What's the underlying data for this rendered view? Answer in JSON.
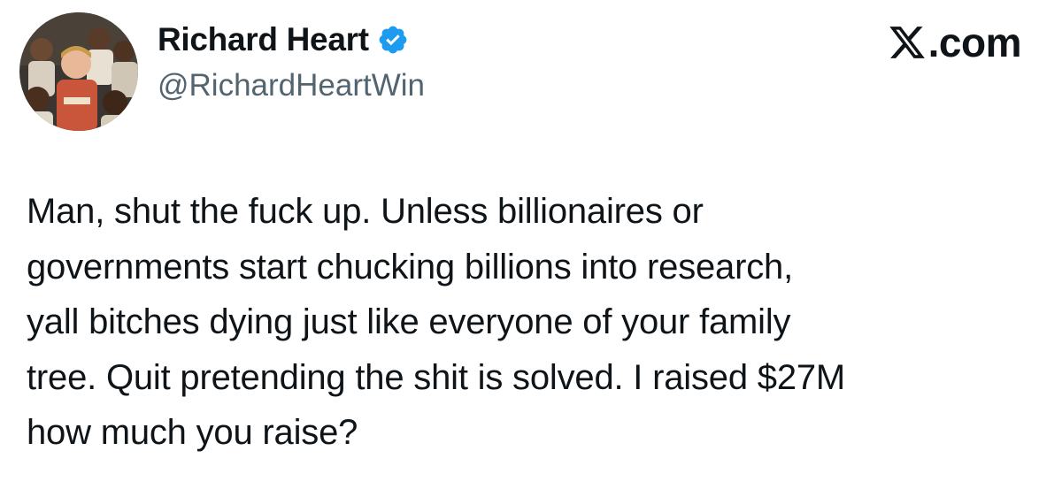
{
  "author": {
    "display_name": "Richard Heart",
    "handle": "@RichardHeartWin",
    "verified": true,
    "verified_icon": "verified-badge-icon",
    "avatar_icon": "avatar-photo"
  },
  "brand": {
    "logo_icon": "x-logo-icon",
    "domain": ".com"
  },
  "tweet": {
    "lines": [
      "Man, shut the fuck up. Unless billionaires or",
      "governments start chucking billions into research,",
      "yall bitches dying just like everyone of your family",
      "tree. Quit pretending the shit is solved. I raised $27M",
      "how much you raise?"
    ]
  },
  "colors": {
    "text": "#0f1419",
    "secondary_text": "#536471",
    "verified_blue": "#1d9bf0",
    "background": "#ffffff"
  }
}
